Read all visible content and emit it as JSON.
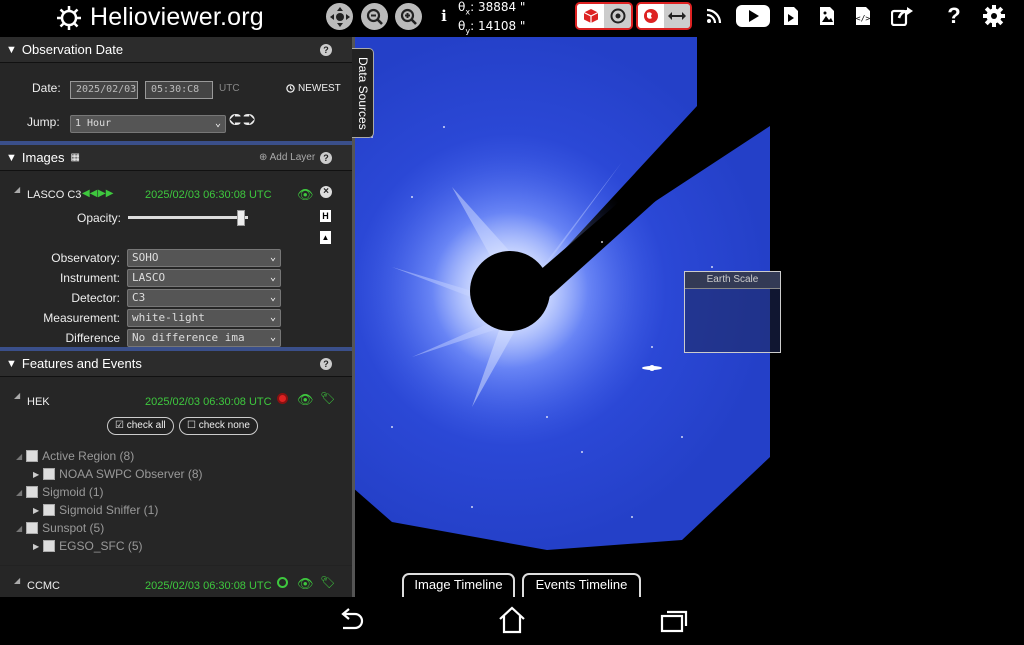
{
  "app": {
    "title": "Helioviewer.org"
  },
  "toolbar": {
    "coord_x": "38884 \"",
    "coord_y": "14108 \"",
    "coord_x_label": "θ",
    "coord_x_sub": "x",
    "coord_y_label": "θ",
    "coord_y_sub": "y",
    "icons": [
      "sun-logo-icon",
      "center-view-icon",
      "zoom-out-icon",
      "zoom-in-icon",
      "info-icon",
      "3d-cube-icon",
      "target-icon",
      "globe-icon",
      "scale-arrows-icon",
      "rss-icon",
      "youtube-icon",
      "movie-icon",
      "screenshot-icon",
      "embed-icon",
      "share-icon",
      "help-icon",
      "settings-icon"
    ]
  },
  "observation": {
    "header": "Observation Date",
    "date_label": "Date:",
    "date_value": "2025/02/03",
    "time_value": "05:30:C8",
    "tz": "UTC",
    "newest_label": "NEWEST",
    "jump_label": "Jump:",
    "jump_value": "1 Hour"
  },
  "images": {
    "header": "Images",
    "add_layer": "Add Layer",
    "layer_name": "LASCO C3",
    "layer_time": "2025/02/03 06:30:08 UTC",
    "opacity_label": "Opacity:",
    "opacity_fraction": 0.94,
    "fields": [
      {
        "label": "Observatory:",
        "value": "SOHO"
      },
      {
        "label": "Instrument:",
        "value": "LASCO"
      },
      {
        "label": "Detector:",
        "value": "C3"
      },
      {
        "label": "Measurement:",
        "value": "white-light"
      },
      {
        "label": "Difference",
        "value": "No difference ima"
      }
    ]
  },
  "features": {
    "header": "Features and Events",
    "hek_name": "HEK",
    "hek_time": "2025/02/03 06:30:08 UTC",
    "check_all": "check all",
    "check_none": "check none",
    "tree": [
      {
        "label": "Active Region (8)",
        "level": 0
      },
      {
        "label": "NOAA SWPC Observer (8)",
        "level": 1
      },
      {
        "label": "Sigmoid (1)",
        "level": 0
      },
      {
        "label": "Sigmoid Sniffer (1)",
        "level": 1
      },
      {
        "label": "Sunspot (5)",
        "level": 0
      },
      {
        "label": "EGSO_SFC (5)",
        "level": 1
      }
    ],
    "ccmc_name": "CCMC",
    "ccmc_time": "2025/02/03 06:30:08 UTC"
  },
  "viewport": {
    "data_sources": "Data Sources",
    "earth_scale": "Earth Scale",
    "image_timeline": "Image Timeline",
    "events_timeline": "Events Timeline"
  },
  "colors": {
    "accent_red": "#d22222",
    "event_green": "#3ec83e",
    "corona_blue": "#2a49d8"
  }
}
